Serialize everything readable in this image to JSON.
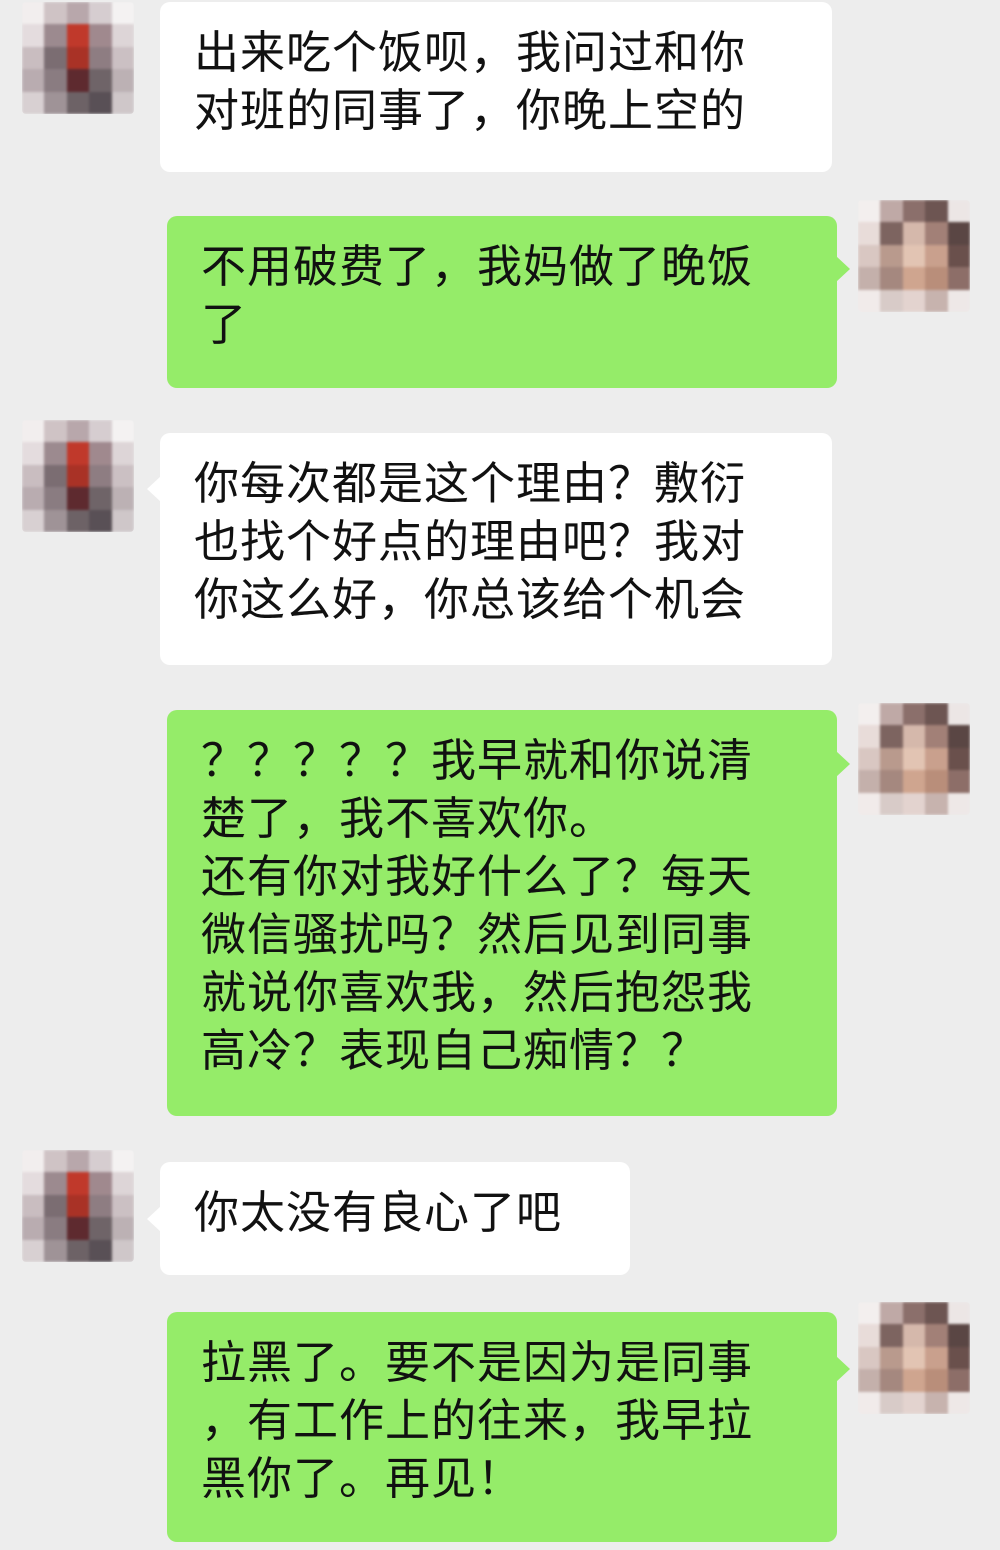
{
  "chat": {
    "messages": [
      {
        "side": "received",
        "text": "出来吃个饭呗，我问过和你\n对班的同事了，你晚上空的"
      },
      {
        "side": "sent",
        "text": "不用破费了，我妈做了晚饭\n了"
      },
      {
        "side": "received",
        "text": "你每次都是这个理由？敷衍\n也找个好点的理由吧？我对\n你这么好，你总该给个机会"
      },
      {
        "side": "sent",
        "text": "？？？？？我早就和你说清\n楚了，我不喜欢你。\n还有你对我好什么了？每天\n微信骚扰吗？然后见到同事\n就说你喜欢我，然后抱怨我\n高冷？表现自己痴情？？"
      },
      {
        "side": "received",
        "text": "你太没有良心了吧"
      },
      {
        "side": "sent",
        "text": "拉黑了。要不是因为是同事\n，有工作上的往来，我早拉\n黑你了。再见！"
      }
    ]
  },
  "colors": {
    "background": "#ededed",
    "received_bubble": "#ffffff",
    "sent_bubble": "#95ec69",
    "text": "#111111"
  },
  "avatars": {
    "received": {
      "icon": "pixelated-avatar-icon"
    },
    "sent": {
      "icon": "pixelated-avatar-icon"
    }
  }
}
